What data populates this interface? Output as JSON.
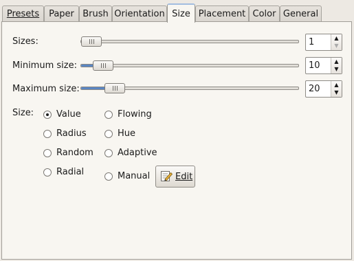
{
  "tabs": [
    {
      "label": "Presets",
      "active": false
    },
    {
      "label": "Paper",
      "active": false
    },
    {
      "label": "Brush",
      "active": false
    },
    {
      "label": "Orientation",
      "active": false
    },
    {
      "label": "Size",
      "active": true
    },
    {
      "label": "Placement",
      "active": false
    },
    {
      "label": "Color",
      "active": false
    },
    {
      "label": "General",
      "active": false
    }
  ],
  "sliders": [
    {
      "label": "Sizes:",
      "value": "1",
      "fraction": 0.0
    },
    {
      "label": "Minimum size:",
      "value": "10",
      "fraction": 0.06
    },
    {
      "label": "Maximum size:",
      "value": "20",
      "fraction": 0.12
    }
  ],
  "size": {
    "label": "Size:",
    "options": [
      "Value",
      "Radius",
      "Random",
      "Radial",
      "Flowing",
      "Hue",
      "Adaptive",
      "Manual"
    ],
    "selected": "Value",
    "edit_button": "Edit",
    "edit_icon": "pencil-icon"
  },
  "colors": {
    "accent": "#5a86c3",
    "tab_highlight": "#a2bde0"
  }
}
